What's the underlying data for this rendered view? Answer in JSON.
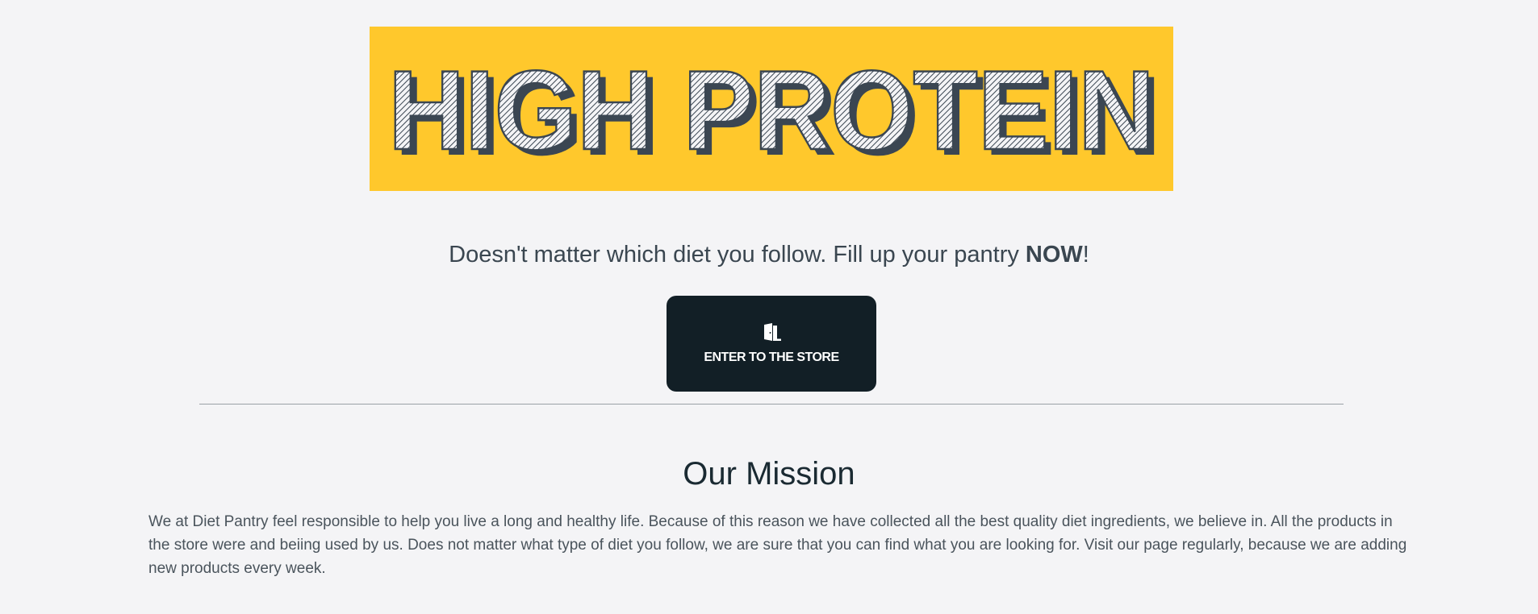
{
  "banner": {
    "text": "HIGH PROTEIN",
    "background_color": "#ffc82c",
    "text_color": "#3b4652"
  },
  "tagline": {
    "prefix": "Doesn't matter which diet you follow. Fill up your pantry ",
    "emphasis": "NOW",
    "suffix": "!"
  },
  "store_button": {
    "icon": "door-open-icon",
    "label": "ENTER TO THE STORE",
    "background_color": "#121f26"
  },
  "mission": {
    "title": "Our Mission",
    "body": "We at Diet Pantry feel responsible to help you live a long and healthy life. Because of this reason we have collected all the best quality diet ingredients, we believe in. All the products in the store were and beiing used by us. Does not matter what type of diet you follow, we are sure that you can find what you are looking for. Visit our page regularly, because we are adding new products every week."
  }
}
